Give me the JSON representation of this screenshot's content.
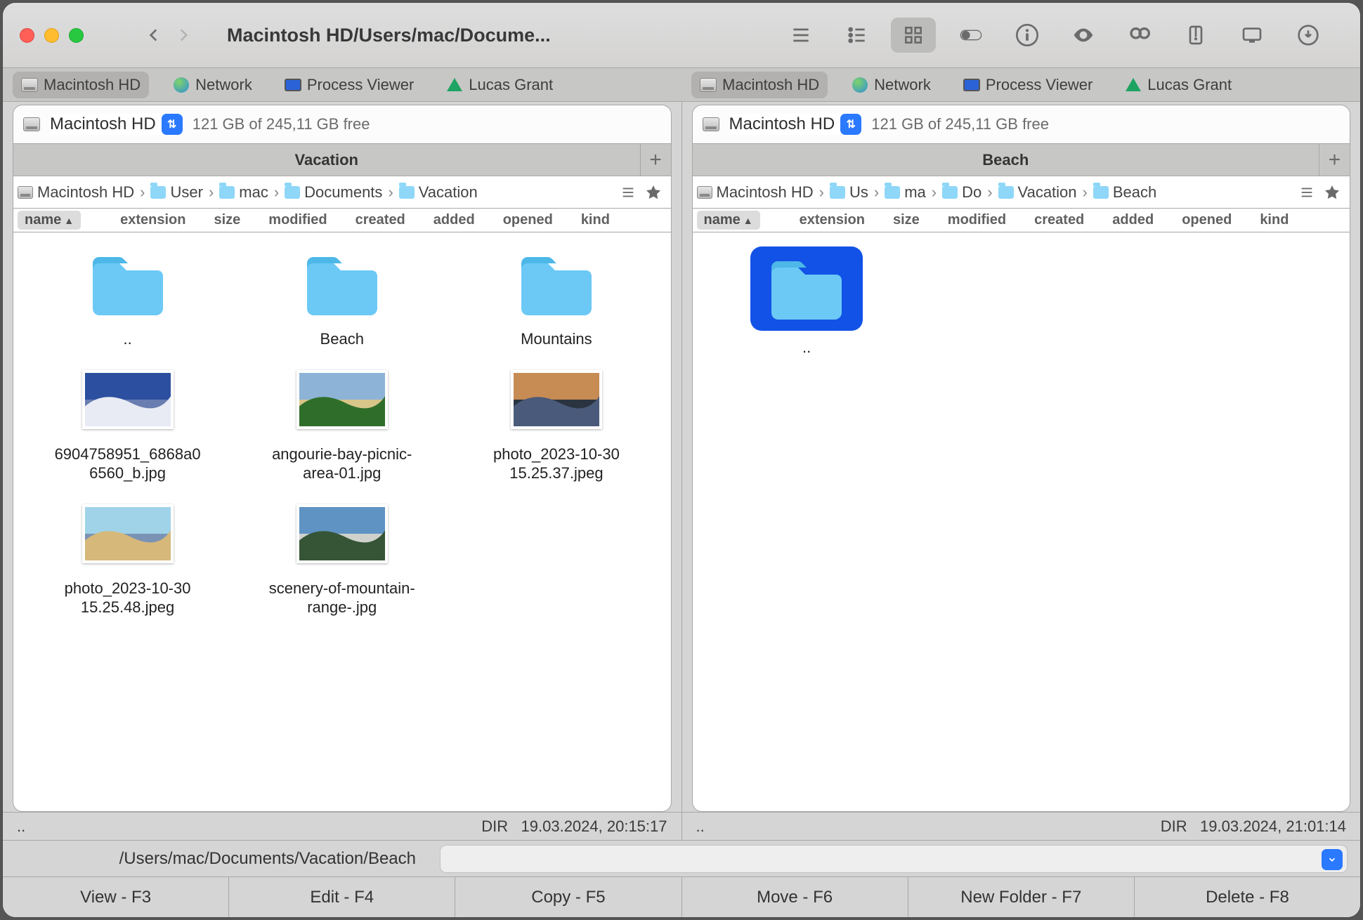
{
  "window": {
    "title": "Macintosh HD/Users/mac/Docume..."
  },
  "favorites": [
    {
      "label": "Macintosh HD",
      "icon": "hd",
      "active": true
    },
    {
      "label": "Network",
      "icon": "globe"
    },
    {
      "label": "Process Viewer",
      "icon": "monitor"
    },
    {
      "label": "Lucas Grant",
      "icon": "gdrive"
    }
  ],
  "left": {
    "volume": "Macintosh HD",
    "free": "121 GB of 245,11 GB free",
    "tab": "Vacation",
    "crumbs": [
      {
        "label": "Macintosh HD",
        "icon": "hd"
      },
      {
        "label": "User",
        "icon": "folder-user"
      },
      {
        "label": "mac",
        "icon": "folder-user"
      },
      {
        "label": "Documents",
        "icon": "folder"
      },
      {
        "label": "Vacation",
        "icon": "folder"
      }
    ],
    "columns": [
      "name",
      "extension",
      "size",
      "modified",
      "created",
      "added",
      "opened",
      "kind"
    ],
    "sorted": "name",
    "items": [
      {
        "type": "folder",
        "label": ".."
      },
      {
        "type": "folder",
        "label": "Beach"
      },
      {
        "type": "folder",
        "label": "Mountains"
      },
      {
        "type": "image",
        "label": "6904758951_6868a06560_b.jpg",
        "colors": [
          "#2c4fa0",
          "#e8ebf3",
          "#6a7db1"
        ]
      },
      {
        "type": "image",
        "label": "angourie-bay-picnic-area-01.jpg",
        "colors": [
          "#8db3d6",
          "#2f6e2a",
          "#d7c58a"
        ]
      },
      {
        "type": "image",
        "label": "photo_2023-10-30 15.25.37.jpeg",
        "colors": [
          "#c78b54",
          "#4a5a7a",
          "#2a3440"
        ]
      },
      {
        "type": "image",
        "label": "photo_2023-10-30 15.25.48.jpeg",
        "colors": [
          "#a0d3e8",
          "#d6b87a",
          "#7a93b4"
        ]
      },
      {
        "type": "image",
        "label": "scenery-of-mountain-range-.jpg",
        "colors": [
          "#5f93c4",
          "#355536",
          "#cfd2cc"
        ]
      }
    ],
    "status": {
      "left": "..",
      "dir": "DIR",
      "time": "19.03.2024, 20:15:17"
    }
  },
  "right": {
    "volume": "Macintosh HD",
    "free": "121 GB of 245,11 GB free",
    "tab": "Beach",
    "crumbs": [
      {
        "label": "Macintosh HD",
        "icon": "hd"
      },
      {
        "label": "Us",
        "icon": "folder-user"
      },
      {
        "label": "ma",
        "icon": "folder-user"
      },
      {
        "label": "Do",
        "icon": "folder"
      },
      {
        "label": "Vacation",
        "icon": "folder"
      },
      {
        "label": "Beach",
        "icon": "folder"
      }
    ],
    "columns": [
      "name",
      "extension",
      "size",
      "modified",
      "created",
      "added",
      "opened",
      "kind"
    ],
    "sorted": "name",
    "items": [
      {
        "type": "folder",
        "label": "..",
        "selected": true
      }
    ],
    "status": {
      "left": "..",
      "dir": "DIR",
      "time": "19.03.2024, 21:01:14"
    }
  },
  "pathbar": "/Users/mac/Documents/Vacation/Beach",
  "fkeys": [
    "View - F3",
    "Edit - F4",
    "Copy - F5",
    "Move - F6",
    "New Folder - F7",
    "Delete - F8"
  ]
}
